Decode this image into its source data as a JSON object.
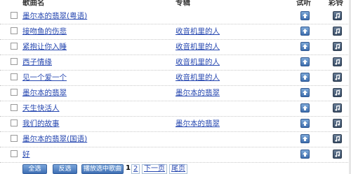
{
  "header": {
    "song": "歌曲名",
    "album": "专辑",
    "listen": "试听",
    "ring": "彩铃"
  },
  "rows": [
    {
      "song": "墨尔本的翡翠(粤语)",
      "album": ""
    },
    {
      "song": "接吻鱼的伤悲",
      "album": "收音机里的人"
    },
    {
      "song": "紧抱让你入睡",
      "album": "收音机里的人"
    },
    {
      "song": "西子情缘",
      "album": "收音机里的人"
    },
    {
      "song": "见一个爱一个",
      "album": "收音机里的人"
    },
    {
      "song": "墨尔本的翡翠",
      "album": "墨尔本的翡翠"
    },
    {
      "song": "天生快活人",
      "album": ""
    },
    {
      "song": "我们的故事",
      "album": "墨尔本的翡翠"
    },
    {
      "song": "墨尔本的翡翠(国语)",
      "album": ""
    },
    {
      "song": "好",
      "album": ""
    }
  ],
  "footer": {
    "select_all": "全选",
    "invert": "反选",
    "play_selected": "播放选中歌曲",
    "pages": [
      "1",
      "2"
    ],
    "next": "下一页",
    "last": "尾页"
  },
  "colors": {
    "link": "#2647b0",
    "button": "#3f6fb4"
  },
  "icons": {
    "listen": "play-icon",
    "ring": "ringtone-icon"
  }
}
